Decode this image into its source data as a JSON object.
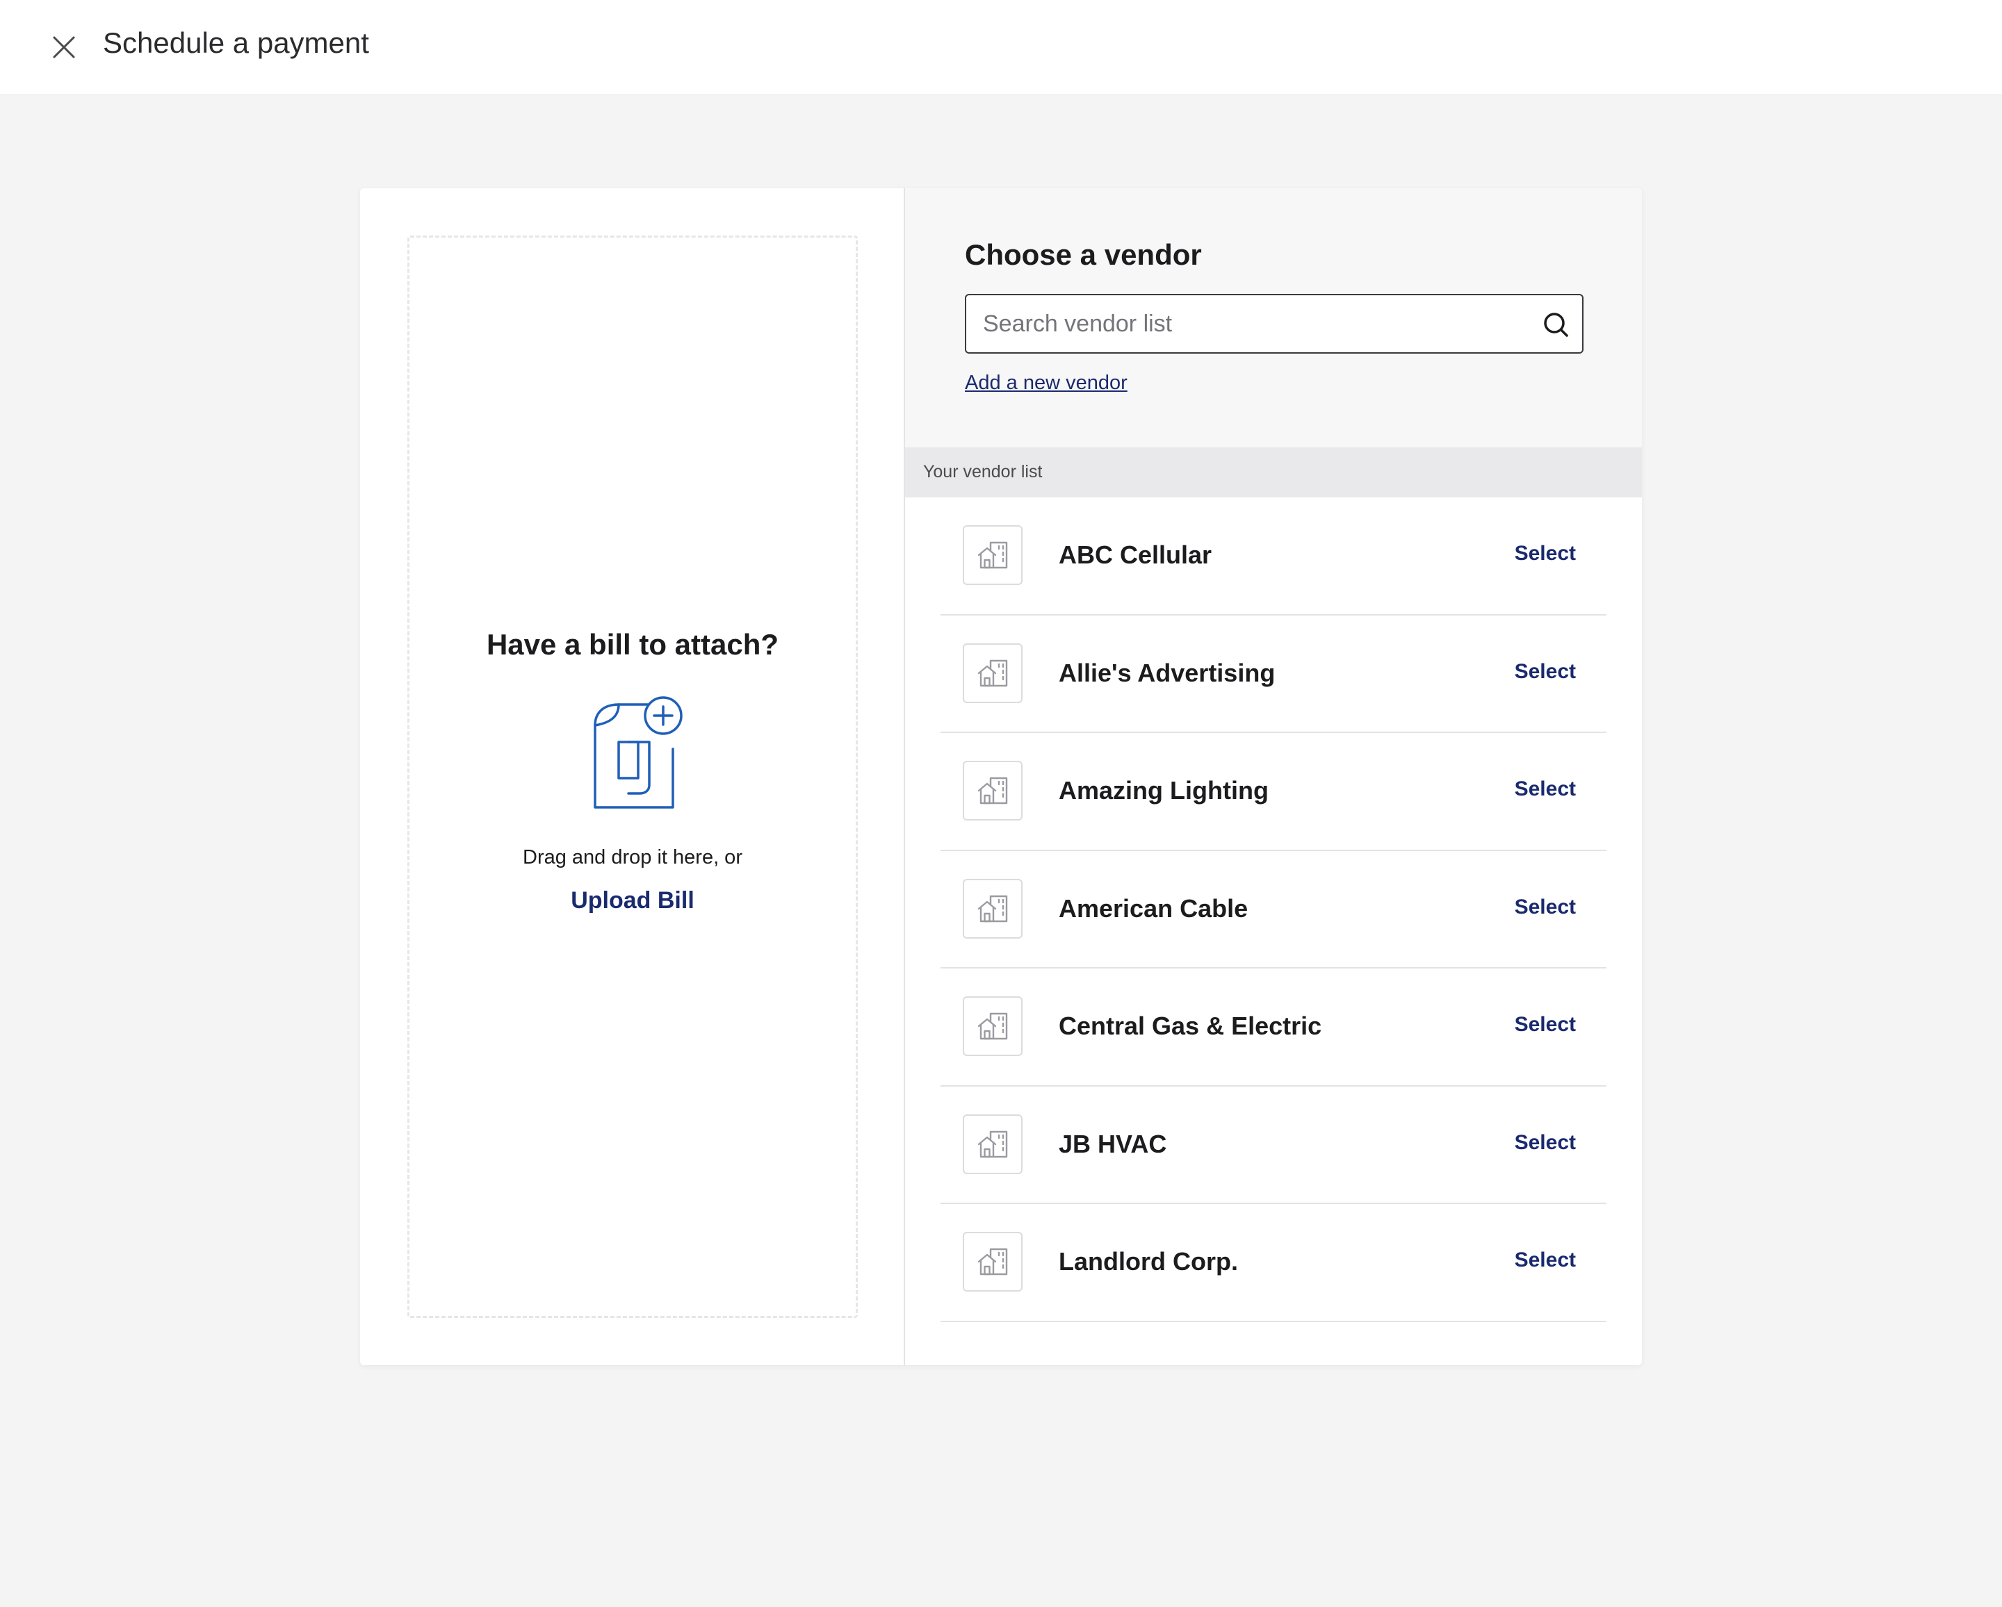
{
  "header": {
    "title": "Schedule a payment",
    "close_icon": "close-icon"
  },
  "bill": {
    "title": "Have a bill to attach?",
    "icon": "bill-upload-icon",
    "hint": "Drag and drop it here, or",
    "upload_label": "Upload Bill"
  },
  "vendor": {
    "title": "Choose a vendor",
    "search_placeholder": "Search vendor list",
    "search_value": "",
    "search_icon": "search-icon",
    "add_link": "Add a new vendor",
    "list_label": "Your vendor list",
    "select_label": "Select",
    "items": [
      {
        "name": "ABC Cellular",
        "icon": "building-icon"
      },
      {
        "name": "Allie's Advertising",
        "icon": "building-icon"
      },
      {
        "name": "Amazing Lighting",
        "icon": "building-icon"
      },
      {
        "name": "American Cable",
        "icon": "building-icon"
      },
      {
        "name": "Central Gas & Electric",
        "icon": "building-icon"
      },
      {
        "name": "JB HVAC",
        "icon": "building-icon"
      },
      {
        "name": "Landlord Corp.",
        "icon": "building-icon"
      }
    ]
  },
  "colors": {
    "accent": "#1a2a6e",
    "icon_blue": "#1f5fb8",
    "background": "#f4f4f5",
    "panel": "#f7f7f8"
  }
}
